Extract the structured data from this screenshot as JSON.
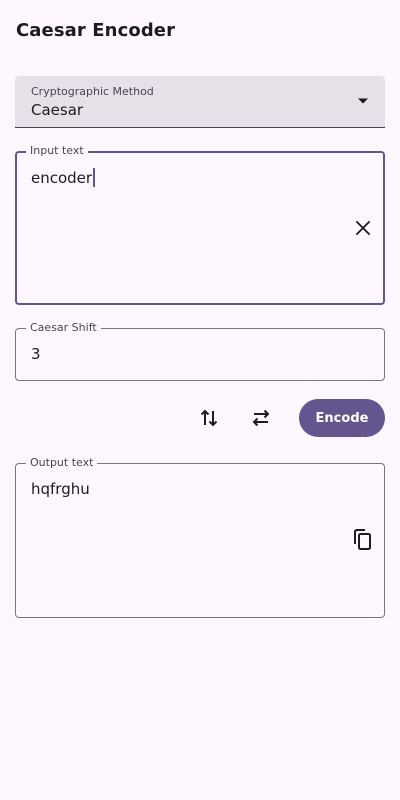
{
  "app": {
    "title": "Caesar Encoder"
  },
  "method_dropdown": {
    "label": "Cryptographic Method",
    "value": "Caesar"
  },
  "input": {
    "label": "Input text",
    "value": "encoder",
    "clear_icon": "close-icon"
  },
  "shift": {
    "label": "Caesar Shift",
    "value": "3"
  },
  "actions": {
    "swap_vertical_icon": "swap-vertical-icon",
    "swap_horizontal_icon": "swap-horizontal-icon",
    "encode_label": "Encode"
  },
  "output": {
    "label": "Output text",
    "value": "hqfrghu",
    "copy_icon": "copy-icon"
  },
  "colors": {
    "primary": "#65558F",
    "background": "#FEF7FF",
    "dropdown_fill": "#E6E0E9",
    "outline": "#79747E"
  }
}
